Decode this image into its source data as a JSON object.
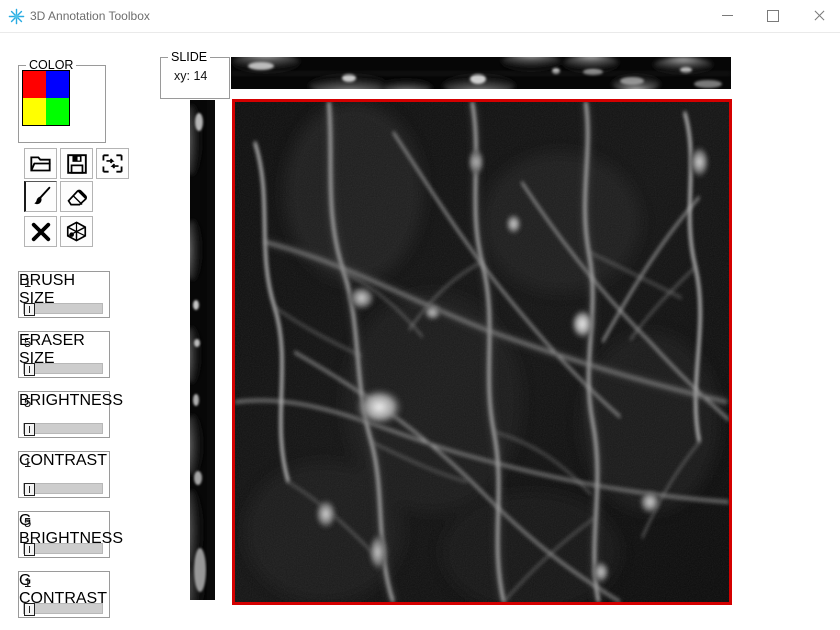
{
  "window": {
    "title": "3D Annotation Toolbox",
    "icon": "snowflake-icon",
    "controls": {
      "minimize": "minimize",
      "maximize": "maximize",
      "close": "close"
    }
  },
  "color_group": {
    "legend": "COLOR",
    "swatches": [
      {
        "name": "red",
        "hex": "#ff0000"
      },
      {
        "name": "blue",
        "hex": "#0000ff"
      },
      {
        "name": "yellow",
        "hex": "#ffff00"
      },
      {
        "name": "green",
        "hex": "#00ff00"
      }
    ]
  },
  "tools": [
    {
      "id": "open",
      "icon": "folder-open-icon",
      "label": "Open",
      "selected": false
    },
    {
      "id": "save",
      "icon": "floppy-save-icon",
      "label": "Save",
      "selected": false
    },
    {
      "id": "fit",
      "icon": "fit-resize-icon",
      "label": "Fit",
      "selected": false
    },
    {
      "id": "brush",
      "icon": "paintbrush-icon",
      "label": "Brush",
      "selected": true
    },
    {
      "id": "eraser",
      "icon": "eraser-icon",
      "label": "Eraser",
      "selected": false
    },
    {
      "id": "clear",
      "icon": "x-cross-icon",
      "label": "Clear",
      "selected": false
    },
    {
      "id": "view3d",
      "icon": "cube-3d-icon",
      "label": "3D View",
      "selected": false
    }
  ],
  "sliders": [
    {
      "id": "brush_size",
      "legend": "BRUSH SIZE",
      "value": "1",
      "percent": 0
    },
    {
      "id": "eraser_size",
      "legend": "ERASER SIZE",
      "value": "5",
      "percent": 0
    },
    {
      "id": "brightness",
      "legend": "BRIGHTNESS",
      "value": "5",
      "percent": 0
    },
    {
      "id": "contrast",
      "legend": "CONTRAST",
      "value": "1",
      "percent": 0
    },
    {
      "id": "g_brightness",
      "legend": "G BRIGHTNESS",
      "value": "5",
      "percent": 0
    },
    {
      "id": "g_contrast",
      "legend": "G CONTRAST",
      "value": "1",
      "percent": 0
    }
  ],
  "slide_group": {
    "legend": "SLIDE",
    "value": "xy: 14"
  },
  "views": {
    "xz": {
      "name": "xz-cross-section",
      "description": "horizontal cross-section strip"
    },
    "yz": {
      "name": "yz-cross-section",
      "description": "vertical cross-section strip"
    },
    "xy": {
      "name": "xy-main-slice",
      "description": "main fluorescence microscopy slice",
      "border_color": "#d40000"
    }
  }
}
